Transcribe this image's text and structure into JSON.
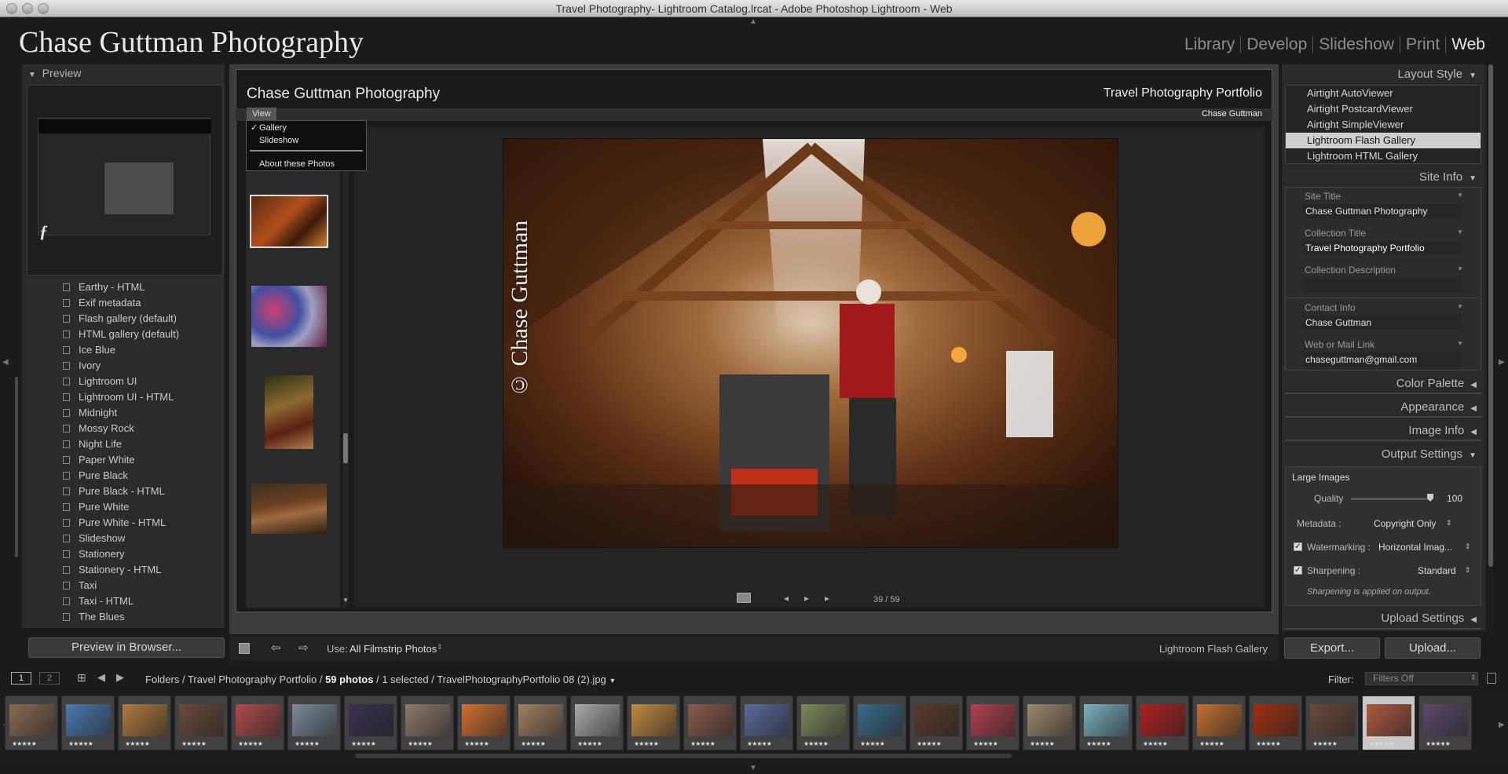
{
  "window": {
    "title": "Travel Photography- Lightroom Catalog.lrcat - Adobe Photoshop Lightroom - Web"
  },
  "identity_plate": "Chase Guttman Photography",
  "modules": [
    {
      "label": "Library",
      "active": false
    },
    {
      "label": "Develop",
      "active": false
    },
    {
      "label": "Slideshow",
      "active": false
    },
    {
      "label": "Print",
      "active": false
    },
    {
      "label": "Web",
      "active": true
    }
  ],
  "left_panel": {
    "preview_header": "Preview",
    "templates": [
      "Earthy - HTML",
      "Exif metadata",
      "Flash gallery (default)",
      "HTML gallery (default)",
      "Ice Blue",
      "Ivory",
      "Lightroom UI",
      "Lightroom UI - HTML",
      "Midnight",
      "Mossy Rock",
      "Night Life",
      "Paper White",
      "Pure Black",
      "Pure Black - HTML",
      "Pure White",
      "Pure White - HTML",
      "Slideshow",
      "Stationery",
      "Stationery - HTML",
      "Taxi",
      "Taxi - HTML",
      "The Blues"
    ],
    "preview_button": "Preview in Browser..."
  },
  "gallery": {
    "site_title": "Chase Guttman Photography",
    "collection_title": "Travel Photography Portfolio",
    "contact": "Chase Guttman",
    "view_menu": "View",
    "view_options": [
      "Gallery",
      "Slideshow"
    ],
    "view_checked": "✓",
    "about": "About these Photos",
    "watermark": "© Chase Guttman",
    "counter": "39 / 59"
  },
  "toolbar": {
    "use_label": "Use:",
    "use_value": "All Filmstrip Photos",
    "layout_name": "Lightroom Flash Gallery"
  },
  "right_panel": {
    "layout_style": "Layout Style",
    "layouts": [
      {
        "label": "Airtight AutoViewer",
        "selected": false
      },
      {
        "label": "Airtight PostcardViewer",
        "selected": false
      },
      {
        "label": "Airtight SimpleViewer",
        "selected": false
      },
      {
        "label": "Lightroom Flash Gallery",
        "selected": true
      },
      {
        "label": "Lightroom HTML Gallery",
        "selected": false
      }
    ],
    "site_info": "Site Info",
    "fields": [
      {
        "label": "Site Title",
        "value": "Chase Guttman Photography"
      },
      {
        "label": "Collection Title",
        "value": "Travel Photography Portfolio"
      },
      {
        "label": "Collection Description",
        "value": ""
      },
      {
        "label": "Contact Info",
        "value": "Chase Guttman"
      },
      {
        "label": "Web or Mail Link",
        "value": "chaseguttman@gmail.com"
      }
    ],
    "collapsed_panels": [
      "Color Palette",
      "Appearance",
      "Image Info"
    ],
    "output_settings": "Output Settings",
    "large_images": "Large Images",
    "quality_label": "Quality",
    "quality_value": "100",
    "quality_fraction": 1.0,
    "metadata_label": "Metadata :",
    "metadata_value": "Copyright Only",
    "watermarking_label": "Watermarking :",
    "watermarking_value": "Horizontal Imag...",
    "sharpening_label": "Sharpening :",
    "sharpening_value": "Standard",
    "sharpening_note": "Sharpening is applied on output.",
    "upload_settings": "Upload Settings",
    "export_button": "Export...",
    "upload_button": "Upload..."
  },
  "filmstrip": {
    "screen1": "1",
    "screen2": "2",
    "path_prefix": "Folders / Travel Photography Portfolio /",
    "photo_count": "59 photos",
    "path_suffix": "/ 1 selected / TravelPhotographyPortfolio 08 (2).jpg",
    "filter_label": "Filter:",
    "filter_value": "Filters Off",
    "stars": "★★★★★"
  }
}
